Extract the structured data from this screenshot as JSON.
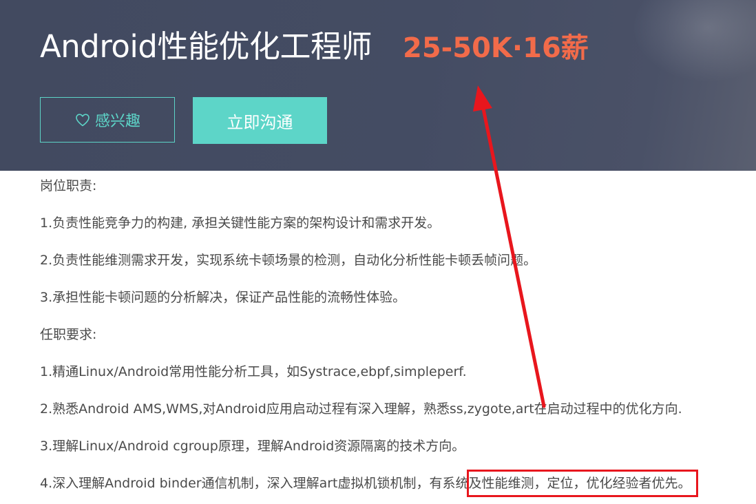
{
  "job": {
    "title": "Android性能优化工程师",
    "salary": "25-50K·16薪"
  },
  "actions": {
    "interest_label": "感兴趣",
    "chat_label": "立即沟通"
  },
  "description": {
    "duties_heading": "岗位职责:",
    "duties": [
      "1.负责性能竞争力的构建, 承担关键性能方案的架构设计和需求开发。",
      "2.负责性能维测需求开发，实现系统卡顿场景的检测，自动化分析性能卡顿丢帧问题。",
      "3.承担性能卡顿问题的分析解决，保证产品性能的流畅性体验。"
    ],
    "requirements_heading": "任职要求:",
    "requirements": [
      "1.精通Linux/Android常用性能分析工具，如Systrace,ebpf,simpleperf.",
      "2.熟悉Android AMS,WMS,对Android应用启动过程有深入理解，熟悉ss,zygote,art在启动过程中的优化方向.",
      "3.理解Linux/Android cgroup原理，理解Android资源隔离的技术方向。",
      "4.深入理解Android binder通信机制，深入理解art虚拟机锁机制，有系统及性能维测，定位，优化经验者优先。"
    ]
  },
  "annotation": {
    "color": "#e8161d",
    "highlighted_text": "系统及性能维测，定位，优化经验者",
    "arrow_points_to": "salary"
  },
  "colors": {
    "header_bg": "#444c63",
    "salary": "#f26b4a",
    "accent": "#5dd5c8",
    "body_text": "#4a4a4a"
  },
  "icons": {
    "interest": "heart-outline-icon"
  }
}
